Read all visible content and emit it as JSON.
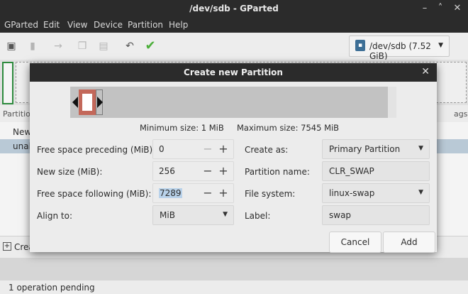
{
  "window": {
    "title": "/dev/sdb - GParted"
  },
  "menu": [
    "GParted",
    "Edit",
    "View",
    "Device",
    "Partition",
    "Help"
  ],
  "toolbar": {
    "icons": [
      "new-partition-icon",
      "delete-icon",
      "resize-move-icon",
      "copy-icon",
      "paste-icon",
      "undo-icon",
      "apply-icon"
    ],
    "apply_color": "#4caf3a",
    "device_selector": "/dev/sdb (7.52 GiB)"
  },
  "partition_list": {
    "header_left": "Partitio",
    "header_right": "ags",
    "rows": [
      "New",
      "unal"
    ]
  },
  "pending": {
    "label": "Crea"
  },
  "status": {
    "text": "1 operation pending"
  },
  "dialog": {
    "title": "Create new Partition",
    "min_size": "Minimum size: 1 MiB",
    "max_size": "Maximum size: 7545 MiB",
    "fields": {
      "free_before_label": "Free space preceding (MiB):",
      "free_before_value": "0",
      "new_size_label": "New size (MiB):",
      "new_size_value": "256",
      "free_after_label": "Free space following (MiB):",
      "free_after_value": "7289",
      "align_label": "Align to:",
      "align_value": "MiB",
      "create_as_label": "Create as:",
      "create_as_value": "Primary Partition",
      "name_label": "Partition name:",
      "name_value": "CLR_SWAP",
      "fs_label": "File system:",
      "fs_value": "linux-swap",
      "label_label": "Label:",
      "label_value": "swap"
    },
    "spin_minus": "−",
    "spin_plus": "+",
    "cancel": "Cancel",
    "add": "Add",
    "partition_color": "#c3685a"
  }
}
